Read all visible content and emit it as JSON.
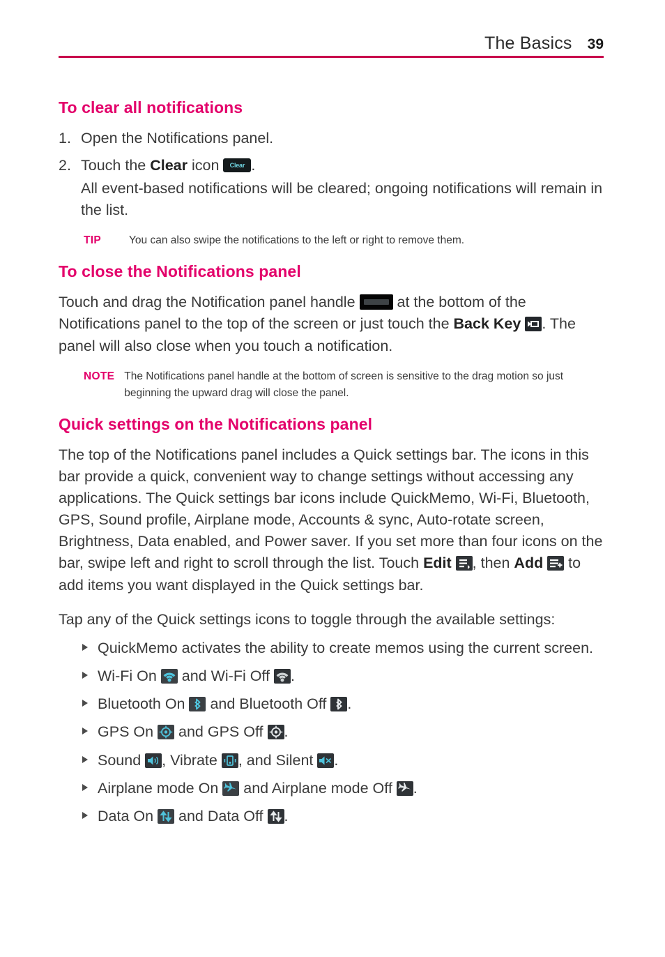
{
  "header": {
    "title": "The Basics",
    "page_number": "39",
    "rule_color": "#c8004b"
  },
  "colors": {
    "heading": "#e3006a",
    "body": "#3a3a3a",
    "icon_on": "#4fc3dc",
    "icon_off": "#cfd4d6"
  },
  "sections": {
    "clear_notifications": {
      "heading": "To clear all notifications",
      "steps": [
        {
          "marker": "1.",
          "text": "Open the Notifications panel."
        },
        {
          "marker": "2.",
          "text_before": "Touch the ",
          "bold": "Clear",
          "text_after": " icon ",
          "icon_name": "clear-icon",
          "icon_label": "Clear",
          "period": ".",
          "continuation": "All event-based notifications will be cleared; ongoing notifications will remain in the list."
        }
      ],
      "tip": {
        "label": "TIP",
        "text": "You can also swipe the notifications to the left or right to remove them."
      }
    },
    "close_panel": {
      "heading": "To close the Notifications panel",
      "paragraph_1": "Touch and drag the Notification panel handle ",
      "paragraph_2": " at the bottom of the Notifications panel to the top of the screen or just touch the ",
      "back_key_bold": "Back Key",
      "paragraph_3": ". The panel will also close when you touch a notification.",
      "note": {
        "label": "NOTE",
        "text": "The Notifications panel handle at the bottom of screen is sensitive to the drag motion so just beginning the upward drag will close the panel."
      }
    },
    "quick_settings": {
      "heading": "Quick settings on the Notifications panel",
      "paragraph_a": "The top of the Notifications panel includes a Quick settings bar. The icons in this bar provide a quick, convenient way to change settings without accessing any applications. The Quick settings bar icons include QuickMemo, Wi-Fi, Bluetooth, GPS, Sound profile, Airplane mode, Accounts & sync, Auto-rotate screen, Brightness, Data enabled, and Power saver. If you set more than four icons on the bar, swipe left and right to scroll through the list. Touch ",
      "edit_bold": "Edit",
      "paragraph_b": ", then ",
      "add_bold": "Add",
      "paragraph_c": " to add items you want displayed in the Quick settings bar.",
      "paragraph_d": "Tap any of the Quick settings icons to toggle through the available settings:",
      "bullets": [
        {
          "id": "quickmemo",
          "text": "QuickMemo activates the ability to create memos using the current screen."
        },
        {
          "id": "wifi",
          "pre": "Wi-Fi On ",
          "mid": " and Wi-Fi Off ",
          "post": "."
        },
        {
          "id": "bluetooth",
          "pre": "Bluetooth On ",
          "mid": " and Bluetooth Off ",
          "post": "."
        },
        {
          "id": "gps",
          "pre": "GPS On ",
          "mid": " and GPS Off ",
          "post": "."
        },
        {
          "id": "sound",
          "pre": "Sound ",
          "mid": ", Vibrate ",
          "mid2": ", and Silent ",
          "post": "."
        },
        {
          "id": "airplane",
          "pre": "Airplane mode On ",
          "mid": " and Airplane mode Off ",
          "post": "."
        },
        {
          "id": "data",
          "pre": "Data On ",
          "mid": " and Data Off ",
          "post": "."
        }
      ]
    }
  }
}
